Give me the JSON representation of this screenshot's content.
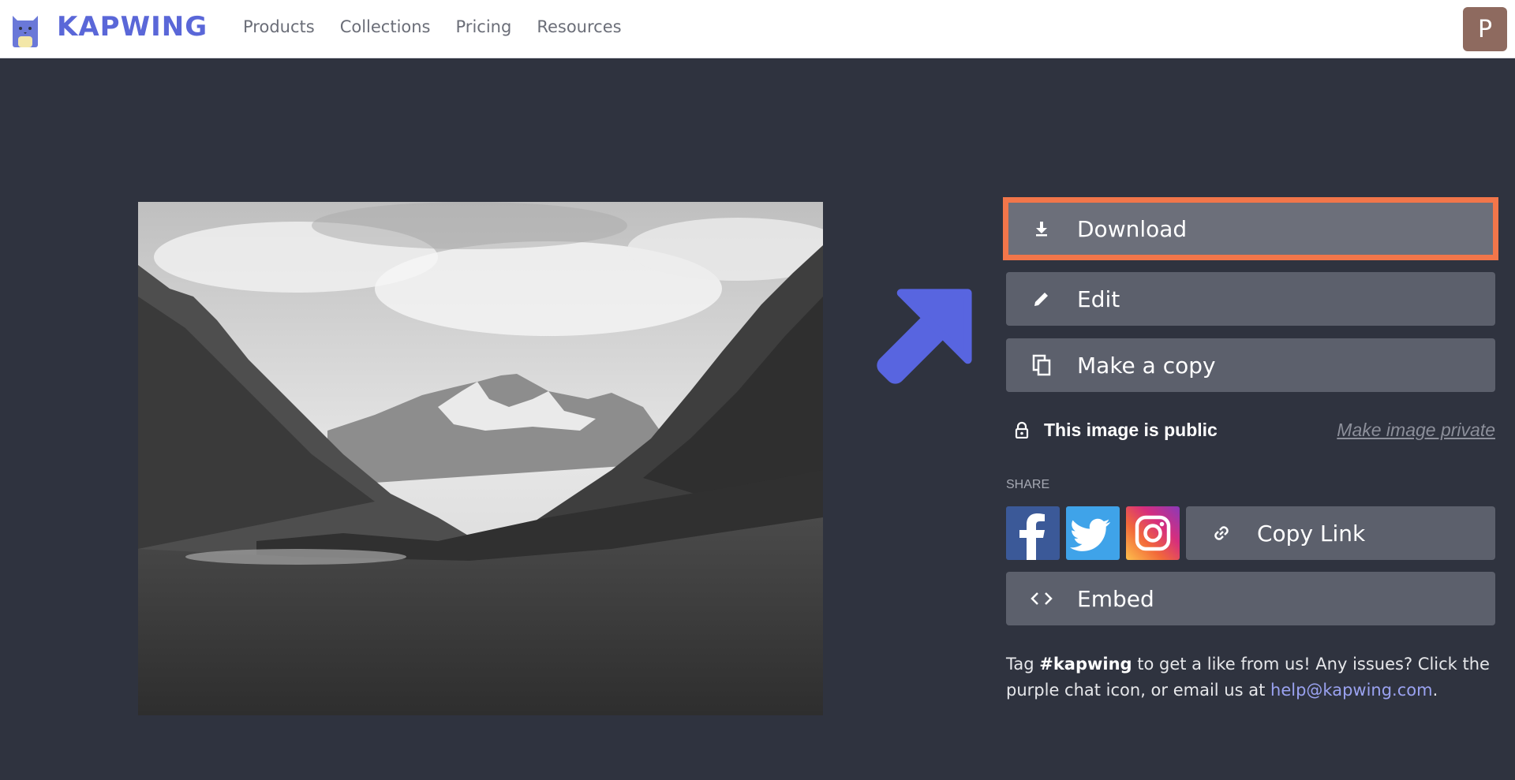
{
  "header": {
    "logo_text": "KAPWING",
    "nav": [
      "Products",
      "Collections",
      "Pricing",
      "Resources"
    ],
    "avatar_initial": "P"
  },
  "actions": {
    "download": "Download",
    "edit": "Edit",
    "make_copy": "Make a copy"
  },
  "visibility": {
    "status": "This image is public",
    "toggle_link": "Make image private"
  },
  "share": {
    "label": "SHARE",
    "networks": [
      "facebook",
      "twitter",
      "instagram"
    ],
    "copy_link": "Copy Link"
  },
  "embed": "Embed",
  "footer": {
    "part1": "Tag ",
    "hashtag": "#kapwing",
    "part2": " to get a like from us! Any issues? Click the purple chat icon, or email us at ",
    "email": "help@kapwing.com",
    "part3": "."
  },
  "colors": {
    "brand": "#5a67d8",
    "highlight": "#f2764a",
    "arrow": "#5865e0",
    "background": "#2f333f"
  }
}
